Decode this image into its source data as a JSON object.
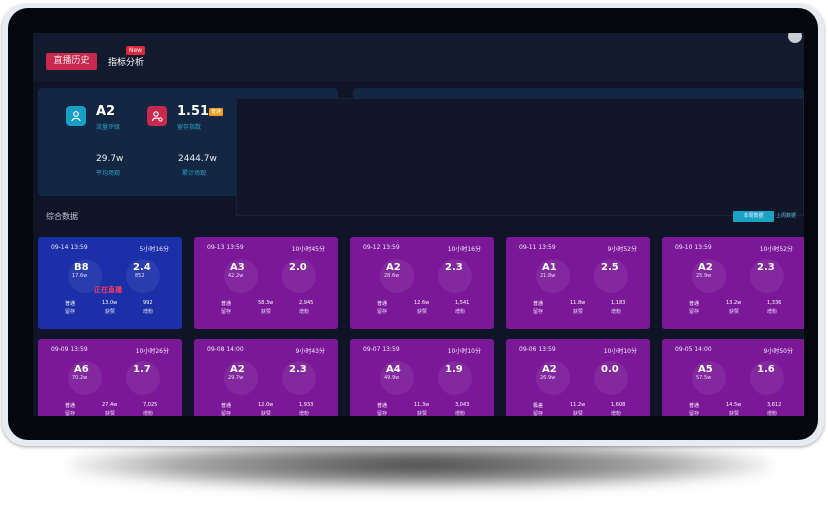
{
  "colors": {
    "active_tab": "#c8294f",
    "card_purple": "#7b1898",
    "card_live": "#1a2fa8",
    "accent_label": "#2fa0c9"
  },
  "tabs": {
    "history": "直播历史",
    "analysis": "指标分析",
    "new_badge": "New"
  },
  "summary": {
    "traffic_grade": "A2",
    "traffic_label": "流量评级",
    "retention_index": "1.51",
    "retention_label": "留存指数",
    "retention_tag": "普通",
    "avg_views": "29.7w",
    "avg_views_label": "平均场观",
    "total_views": "2444.7w",
    "total_views_label": "累计场观"
  },
  "section": {
    "title": "综合数据",
    "button_a": "本周数据",
    "button_b": "上周数据"
  },
  "cards": [
    {
      "date": "09-14 13:59",
      "duration": "5小时16分",
      "grade": "B8",
      "views": "17.6w",
      "score": "2.4",
      "sub": "852",
      "live_text": "正在直播",
      "c1_value": "普通",
      "c1_label": "留存",
      "c2_value": "13.0w",
      "c2_label": "获赞",
      "c3_value": "992",
      "c3_label": "增粉"
    },
    {
      "date": "09-13 13:59",
      "duration": "10小时45分",
      "grade": "A3",
      "views": "42.2w",
      "score": "2.0",
      "sub": "",
      "live_text": "",
      "c1_value": "普通",
      "c1_label": "留存",
      "c2_value": "58.3w",
      "c2_label": "获赞",
      "c3_value": "2,945",
      "c3_label": "增粉"
    },
    {
      "date": "09-12 13:59",
      "duration": "10小时16分",
      "grade": "A2",
      "views": "28.6w",
      "score": "2.3",
      "sub": "",
      "live_text": "",
      "c1_value": "普通",
      "c1_label": "留存",
      "c2_value": "12.6w",
      "c2_label": "获赞",
      "c3_value": "1,541",
      "c3_label": "增粉"
    },
    {
      "date": "09-11 13:59",
      "duration": "9小时52分",
      "grade": "A1",
      "views": "21.8w",
      "score": "2.5",
      "sub": "",
      "live_text": "",
      "c1_value": "普通",
      "c1_label": "留存",
      "c2_value": "11.8w",
      "c2_label": "获赞",
      "c3_value": "1,183",
      "c3_label": "增粉"
    },
    {
      "date": "09-10 13:59",
      "duration": "10小时52分",
      "grade": "A2",
      "views": "25.9w",
      "score": "2.3",
      "sub": "",
      "live_text": "",
      "c1_value": "普通",
      "c1_label": "留存",
      "c2_value": "13.2w",
      "c2_label": "获赞",
      "c3_value": "1,336",
      "c3_label": "增粉"
    },
    {
      "date": "09-09 13:59",
      "duration": "10小时26分",
      "grade": "A6",
      "views": "70.2w",
      "score": "1.7",
      "sub": "",
      "live_text": "",
      "c1_value": "普通",
      "c1_label": "留存",
      "c2_value": "27.4w",
      "c2_label": "获赞",
      "c3_value": "7,025",
      "c3_label": "增粉"
    },
    {
      "date": "09-08 14:00",
      "duration": "9小时43分",
      "grade": "A2",
      "views": "29.7w",
      "score": "2.3",
      "sub": "",
      "live_text": "",
      "c1_value": "普通",
      "c1_label": "留存",
      "c2_value": "12.0w",
      "c2_label": "获赞",
      "c3_value": "1,933",
      "c3_label": "增粉"
    },
    {
      "date": "09-07 13:59",
      "duration": "10小时10分",
      "grade": "A4",
      "views": "49.9w",
      "score": "1.9",
      "sub": "",
      "live_text": "",
      "c1_value": "普通",
      "c1_label": "留存",
      "c2_value": "11.3w",
      "c2_label": "获赞",
      "c3_value": "3,043",
      "c3_label": "增粉"
    },
    {
      "date": "09-06 13:59",
      "duration": "10小时10分",
      "grade": "A2",
      "views": "26.9w",
      "score": "0.0",
      "sub": "",
      "live_text": "",
      "c1_value": "极差",
      "c1_label": "留存",
      "c2_value": "11.2w",
      "c2_label": "获赞",
      "c3_value": "1,608",
      "c3_label": "增粉"
    },
    {
      "date": "09-05 14:00",
      "duration": "9小时50分",
      "grade": "A5",
      "views": "57.5w",
      "score": "1.6",
      "sub": "",
      "live_text": "",
      "c1_value": "普通",
      "c1_label": "留存",
      "c2_value": "14.5w",
      "c2_label": "获赞",
      "c3_value": "3,612",
      "c3_label": "增粉"
    }
  ]
}
